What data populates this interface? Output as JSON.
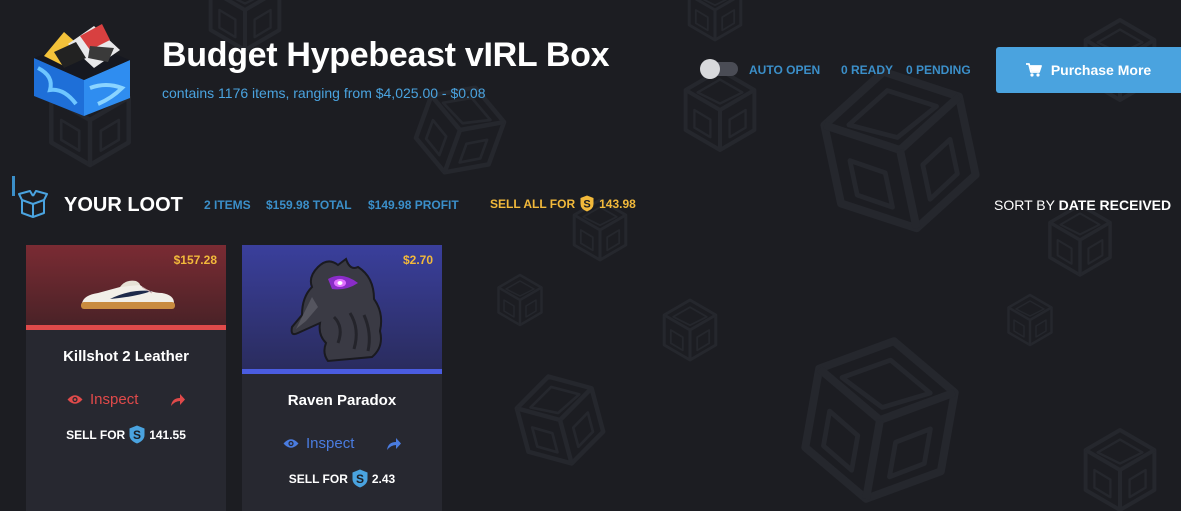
{
  "box": {
    "title": "Budget Hypebeast vIRL Box",
    "subtitle": "contains 1176 items, ranging from $4,025.00 - $0.08"
  },
  "header": {
    "auto_open_label": "AUTO OPEN",
    "auto_open_enabled": false,
    "ready_label": "0 READY",
    "pending_label": "0 PENDING",
    "purchase_label": "Purchase More",
    "purchase_icon": "cart-icon"
  },
  "loot": {
    "title": "YOUR LOOT",
    "items_count": "2 ITEMS",
    "total": "$159.98 TOTAL",
    "profit": "$149.98 PROFIT",
    "sell_all_label": "SELL ALL FOR",
    "sell_all_amount": "143.98",
    "sort_label": "SORT BY",
    "sort_value": "DATE RECEIVED"
  },
  "cards": [
    {
      "name": "Killshot 2 Leather",
      "price": "$157.28",
      "inspect_label": "Inspect",
      "sell_label": "SELL FOR",
      "sell_amount": "141.55",
      "rarity_color": "#e04a4a",
      "image": "sneaker"
    },
    {
      "name": "Raven Paradox",
      "price": "$2.70",
      "inspect_label": "Inspect",
      "sell_label": "SELL FOR",
      "sell_amount": "2.43",
      "rarity_color": "#4a5ce0",
      "image": "raven"
    }
  ],
  "colors": {
    "accent": "#4aa3df",
    "coin": "#f2b93b",
    "background": "#1c1d22",
    "card": "#272830"
  }
}
